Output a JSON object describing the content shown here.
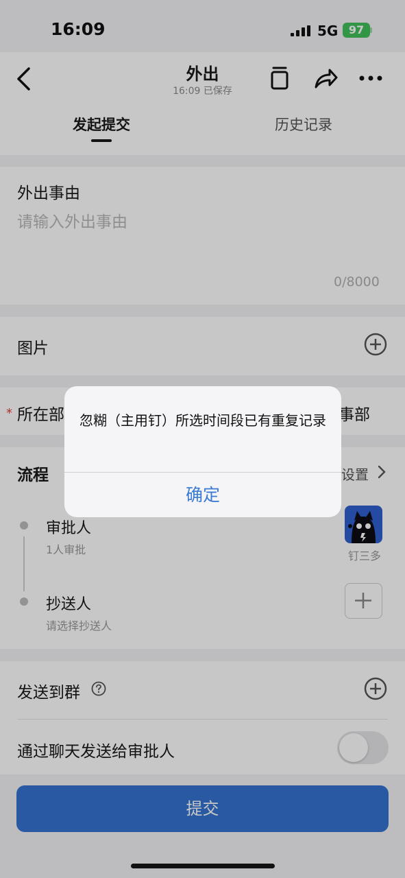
{
  "status_bar": {
    "time": "16:09",
    "network": "5G",
    "battery": "97"
  },
  "header": {
    "title": "外出",
    "subtitle": "16:09 已保存"
  },
  "tabs": [
    {
      "label": "发起提交"
    },
    {
      "label": "历史记录"
    }
  ],
  "reason": {
    "label": "外出事由",
    "placeholder": "请输入外出事由",
    "counter": "0/8000"
  },
  "images": {
    "label": "图片"
  },
  "department": {
    "required_mark": "*",
    "label": "所在部",
    "value": "事部"
  },
  "flow": {
    "label": "流程",
    "settings": "设置",
    "approver": {
      "title": "审批人",
      "subtitle": "1人审批",
      "person": "钉三多"
    },
    "cc": {
      "title": "抄送人",
      "subtitle": "请选择抄送人"
    }
  },
  "send_group": {
    "label": "发送到群"
  },
  "notify_chat": {
    "label": "通过聊天发送给审批人",
    "enabled": false
  },
  "submit": {
    "label": "提交"
  },
  "dialog": {
    "message": "忽糊（主用钉）所选时间段已有重复记录",
    "confirm": "确定"
  },
  "colors": {
    "accent": "#3a7bd5",
    "submit_bg": "#3572d0",
    "battery": "#42c05a"
  }
}
